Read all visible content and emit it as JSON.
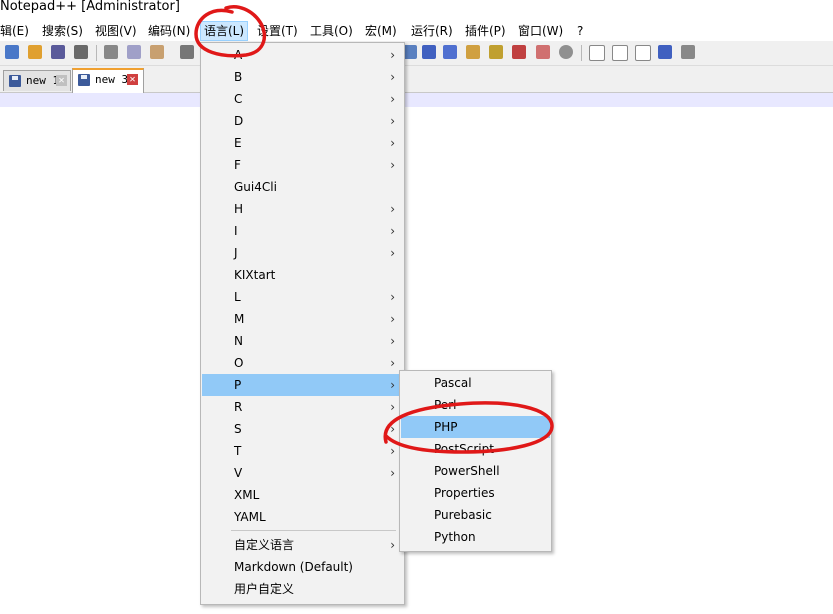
{
  "window": {
    "title": "Notepad++ [Administrator]"
  },
  "menubar": {
    "items": [
      {
        "label": "辑(E)"
      },
      {
        "label": "搜索(S)"
      },
      {
        "label": "视图(V)"
      },
      {
        "label": "编码(N)"
      },
      {
        "label": "语言(L)"
      },
      {
        "label": "设置(T)"
      },
      {
        "label": "工具(O)"
      },
      {
        "label": "宏(M)"
      },
      {
        "label": "运行(R)"
      },
      {
        "label": "插件(P)"
      },
      {
        "label": "窗口(W)"
      },
      {
        "label": "?"
      }
    ],
    "active_index": 4
  },
  "tabs": [
    {
      "label": "new 1",
      "active": false
    },
    {
      "label": "new 3",
      "active": true
    }
  ],
  "language_menu": {
    "items": [
      {
        "label": "A",
        "submenu": true
      },
      {
        "label": "B",
        "submenu": true
      },
      {
        "label": "C",
        "submenu": true
      },
      {
        "label": "D",
        "submenu": true
      },
      {
        "label": "E",
        "submenu": true
      },
      {
        "label": "F",
        "submenu": true
      },
      {
        "label": "Gui4Cli",
        "submenu": false
      },
      {
        "label": "H",
        "submenu": true
      },
      {
        "label": "I",
        "submenu": true
      },
      {
        "label": "J",
        "submenu": true
      },
      {
        "label": "KIXtart",
        "submenu": false
      },
      {
        "label": "L",
        "submenu": true
      },
      {
        "label": "M",
        "submenu": true
      },
      {
        "label": "N",
        "submenu": true
      },
      {
        "label": "O",
        "submenu": true
      },
      {
        "label": "P",
        "submenu": true,
        "highlighted": true
      },
      {
        "label": "R",
        "submenu": true
      },
      {
        "label": "S",
        "submenu": true
      },
      {
        "label": "T",
        "submenu": true
      },
      {
        "label": "V",
        "submenu": true
      },
      {
        "label": "XML",
        "submenu": false
      },
      {
        "label": "YAML",
        "submenu": false
      }
    ],
    "extra_items": [
      {
        "label": "自定义语言",
        "submenu": true
      },
      {
        "label": "Markdown (Default)",
        "submenu": false
      },
      {
        "label": "用户自定义",
        "submenu": false
      }
    ],
    "submenu_arrow": "›"
  },
  "p_submenu": {
    "items": [
      {
        "label": "Pascal"
      },
      {
        "label": "Perl"
      },
      {
        "label": "PHP",
        "highlighted": true
      },
      {
        "label": "PostScript"
      },
      {
        "label": "PowerShell"
      },
      {
        "label": "Properties"
      },
      {
        "label": "Purebasic"
      },
      {
        "label": "Python"
      }
    ]
  },
  "icons": {
    "tab_save": "floppy-disk-icon",
    "tab_close": "close-icon",
    "close_glyph": "✕"
  },
  "colors": {
    "highlight": "#91c9f7",
    "annotation_red": "#e01818",
    "menu_bg": "#f2f2f2"
  }
}
